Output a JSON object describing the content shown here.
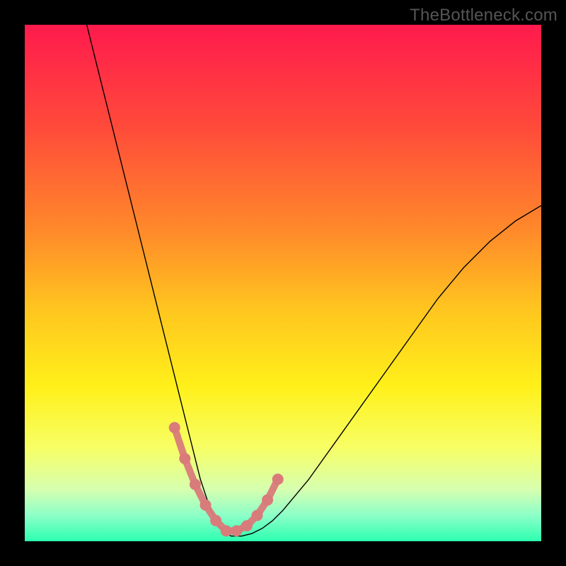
{
  "watermark": "TheBottleneck.com",
  "chart_data": {
    "type": "line",
    "title": "",
    "xlabel": "",
    "ylabel": "",
    "xlim": [
      0,
      100
    ],
    "ylim": [
      0,
      100
    ],
    "grid": false,
    "legend": false,
    "background_gradient": {
      "stops": [
        {
          "offset": 0.0,
          "color": "#ff1a4d"
        },
        {
          "offset": 0.2,
          "color": "#ff4b3a"
        },
        {
          "offset": 0.4,
          "color": "#ff8a2a"
        },
        {
          "offset": 0.55,
          "color": "#ffc51f"
        },
        {
          "offset": 0.7,
          "color": "#fff01a"
        },
        {
          "offset": 0.82,
          "color": "#f7ff66"
        },
        {
          "offset": 0.9,
          "color": "#d6ffb0"
        },
        {
          "offset": 0.95,
          "color": "#8cffc8"
        },
        {
          "offset": 1.0,
          "color": "#2cffb0"
        }
      ]
    },
    "series": [
      {
        "name": "curve",
        "color": "#000000",
        "stroke_width": 1.4,
        "x": [
          12,
          14,
          16,
          18,
          20,
          22,
          24,
          26,
          28,
          29,
          30,
          31,
          32,
          33,
          34,
          35,
          36,
          37,
          38,
          39,
          40,
          42,
          44,
          46,
          48,
          50,
          55,
          60,
          65,
          70,
          75,
          80,
          85,
          90,
          95,
          100
        ],
        "y": [
          100,
          92,
          84,
          76,
          68,
          60,
          52,
          44,
          36,
          32,
          28,
          24,
          20,
          16,
          12,
          9,
          6,
          4,
          2.5,
          1.5,
          1,
          1,
          1.5,
          2.5,
          4,
          6,
          12,
          19,
          26,
          33,
          40,
          47,
          53,
          58,
          62,
          65
        ]
      },
      {
        "name": "markers",
        "color": "#d97b7b",
        "marker_radius": 8,
        "stroke_width": 10,
        "x": [
          29,
          31,
          33,
          35,
          37,
          39,
          41,
          43,
          45,
          47,
          49
        ],
        "y": [
          22,
          16,
          11,
          7,
          4,
          2,
          2,
          3,
          5,
          8,
          12
        ]
      }
    ]
  }
}
